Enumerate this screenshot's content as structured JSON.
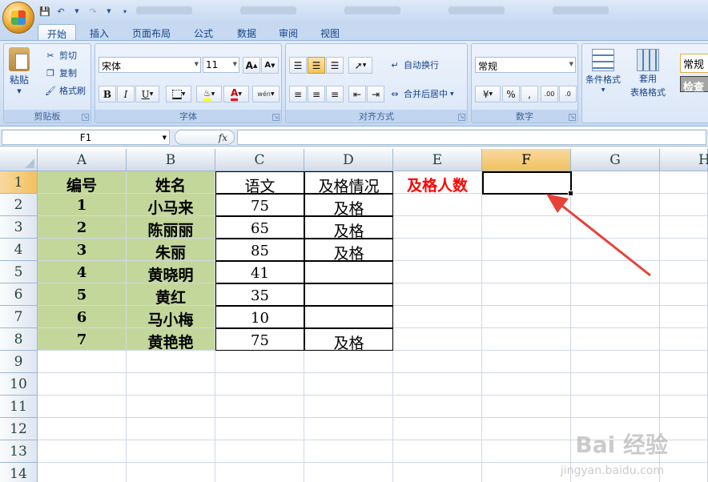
{
  "qat": {
    "save": "save-icon",
    "undo": "undo-icon",
    "redo": "redo-icon"
  },
  "tabs": [
    "开始",
    "插入",
    "页面布局",
    "公式",
    "数据",
    "审阅",
    "视图"
  ],
  "clipboard": {
    "paste": "粘贴",
    "cut": "剪切",
    "copy": "复制",
    "format_painter": "格式刷",
    "label": "剪贴板"
  },
  "font": {
    "name": "宋体",
    "size": "11",
    "bold": "B",
    "italic": "I",
    "underline": "U",
    "label": "字体",
    "grow": "A",
    "shrink": "A",
    "color_a": "A",
    "wen": "wén"
  },
  "alignment": {
    "wrap": "自动换行",
    "merge": "合并后居中",
    "label": "对齐方式"
  },
  "number": {
    "format": "常规",
    "percent": "%",
    "comma": ",",
    "label": "数字"
  },
  "styles": {
    "conditional": "条件格式",
    "table_format_1": "套用",
    "table_format_2": "表格格式",
    "normal": "常规",
    "check": "检查"
  },
  "namebox": "F1",
  "fx": "fx",
  "columns": [
    "A",
    "B",
    "C",
    "D",
    "E",
    "F",
    "G",
    "H"
  ],
  "rows": [
    "1",
    "2",
    "3",
    "4",
    "5",
    "6",
    "7",
    "8",
    "9",
    "10",
    "11",
    "12",
    "13",
    "14"
  ],
  "headers": {
    "id": "编号",
    "name": "姓名",
    "chinese": "语文",
    "status": "及格情况",
    "pass_count": "及格人数"
  },
  "records": [
    {
      "id": "1",
      "name": "小马来",
      "score": "75",
      "status": "及格"
    },
    {
      "id": "2",
      "name": "陈丽丽",
      "score": "65",
      "status": "及格"
    },
    {
      "id": "3",
      "name": "朱丽",
      "score": "85",
      "status": "及格"
    },
    {
      "id": "4",
      "name": "黄晓明",
      "score": "41",
      "status": ""
    },
    {
      "id": "5",
      "name": "黄红",
      "score": "35",
      "status": ""
    },
    {
      "id": "6",
      "name": "马小梅",
      "score": "10",
      "status": ""
    },
    {
      "id": "7",
      "name": "黄艳艳",
      "score": "75",
      "status": "及格"
    }
  ],
  "selected_cell": "F1",
  "colors": {
    "header_green": "#c4d79b",
    "red": "#ff0000",
    "selected": "#f1c15f",
    "arrow": "#e8413a"
  },
  "watermark": {
    "main": "Bai 经验",
    "sub": "jingyan.baidu.com"
  }
}
